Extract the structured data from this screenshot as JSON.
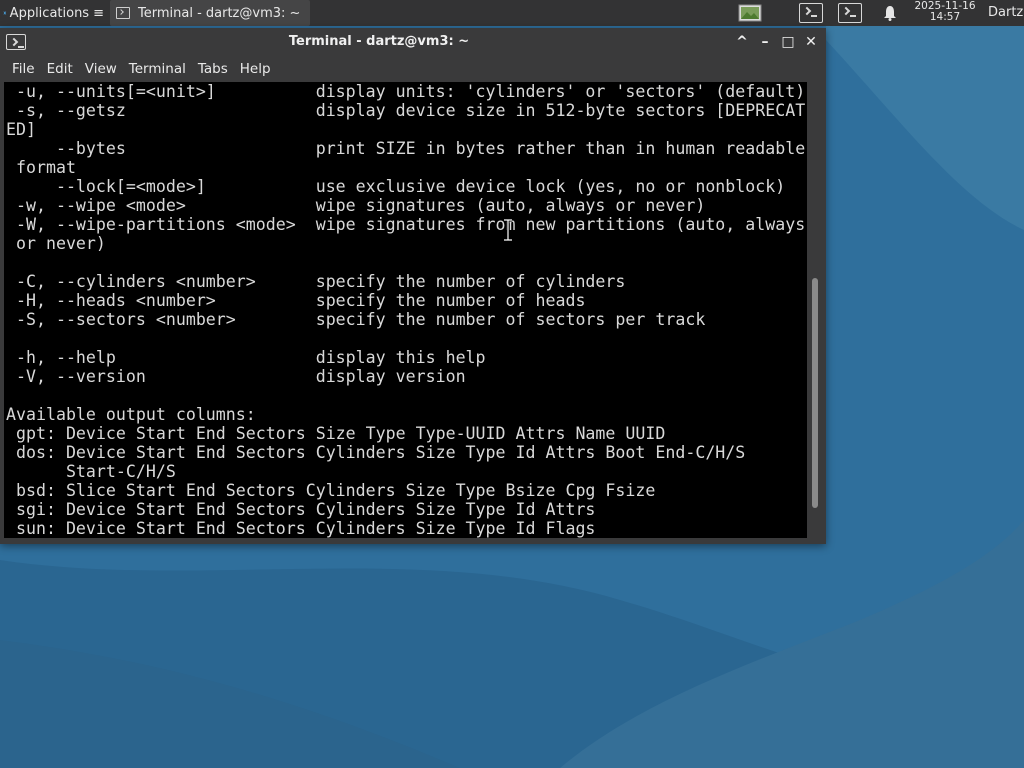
{
  "panel": {
    "applications_label": "Applications",
    "task_label": "Terminal - dartz@vm3: ~",
    "clock_date": "2025-11-16",
    "clock_time": "14:57",
    "user": "Dartz"
  },
  "window": {
    "title": "Terminal - dartz@vm3: ~",
    "controls": {
      "shade": "^",
      "minimize": "–",
      "maximize": "□",
      "close": "✕"
    }
  },
  "menu": {
    "file": "File",
    "edit": "Edit",
    "view": "View",
    "terminal": "Terminal",
    "tabs": "Tabs",
    "help": "Help"
  },
  "terminal": {
    "lines": [
      " -u, --units[=<unit>]          display units: 'cylinders' or 'sectors' (default)",
      " -s, --getsz                   display device size in 512-byte sectors [DEPRECAT",
      "ED]",
      "     --bytes                   print SIZE in bytes rather than in human readable",
      " format",
      "     --lock[=<mode>]           use exclusive device lock (yes, no or nonblock)",
      " -w, --wipe <mode>             wipe signatures (auto, always or never)",
      " -W, --wipe-partitions <mode>  wipe signatures from new partitions (auto, always",
      " or never)",
      "",
      " -C, --cylinders <number>      specify the number of cylinders",
      " -H, --heads <number>          specify the number of heads",
      " -S, --sectors <number>        specify the number of sectors per track",
      "",
      " -h, --help                    display this help",
      " -V, --version                 display version",
      "",
      "Available output columns:",
      " gpt: Device Start End Sectors Size Type Type-UUID Attrs Name UUID",
      " dos: Device Start End Sectors Cylinders Size Type Id Attrs Boot End-C/H/S",
      "      Start-C/H/S",
      " bsd: Slice Start End Sectors Cylinders Size Type Bsize Cpg Fsize",
      " sgi: Device Start End Sectors Cylinders Size Type Id Attrs",
      " sun: Device Start End Sectors Cylinders Size Type Id Flags"
    ],
    "scroll_position": 0.6
  },
  "colors": {
    "desktop": "#2e6d9a",
    "panel": "#333334",
    "window": "#3a3a3b",
    "terminal_bg": "#000000",
    "terminal_fg": "#d9d9d9"
  }
}
